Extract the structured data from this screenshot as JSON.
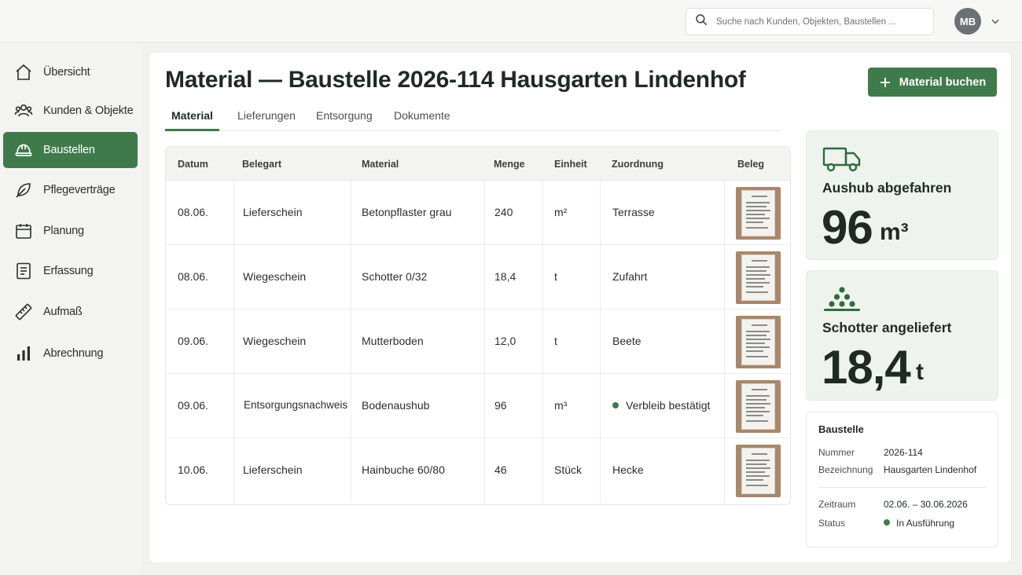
{
  "search": {
    "placeholder": "Suche nach Kunden, Objekten, Baustellen ..."
  },
  "user": {
    "initials": "MB"
  },
  "sidebar": {
    "items": [
      {
        "label": "Übersicht",
        "icon": "home-icon"
      },
      {
        "label": "Kunden & Objekte",
        "icon": "users-icon"
      },
      {
        "label": "Baustellen",
        "icon": "hardhat-icon",
        "active": true
      },
      {
        "label": "Pflegeverträge",
        "icon": "leaf-icon"
      },
      {
        "label": "Planung",
        "icon": "calendar-icon"
      },
      {
        "label": "Erfassung",
        "icon": "document-icon"
      },
      {
        "label": "Aufmaß",
        "icon": "ruler-icon"
      },
      {
        "label": "Abrechnung",
        "icon": "bar-chart-icon"
      }
    ]
  },
  "page": {
    "title": "Material — Baustelle 2026-114 Hausgarten Lindenhof",
    "primary_button": "Material buchen"
  },
  "tabs": [
    "Material",
    "Lieferungen",
    "Entsorgung",
    "Dokumente"
  ],
  "table": {
    "columns": [
      "Datum",
      "Belegart",
      "Material",
      "Menge",
      "Einheit",
      "Zuordnung",
      "Beleg"
    ],
    "rows": [
      {
        "datum": "08.06.",
        "belegart": "Lieferschein",
        "material": "Betonpflaster grau",
        "menge": "240",
        "einheit": "m²",
        "zuordnung": "Terrasse"
      },
      {
        "datum": "08.06.",
        "belegart": "Wiegeschein",
        "material": "Schotter 0/32",
        "menge": "18,4",
        "einheit": "t",
        "zuordnung": "Zufahrt"
      },
      {
        "datum": "09.06.",
        "belegart": "Wiegeschein",
        "material": "Mutterboden",
        "menge": "12,0",
        "einheit": "t",
        "zuordnung": "Beete"
      },
      {
        "datum": "09.06.",
        "belegart": "Entsorgungsnachweis",
        "material": "Bodenaushub",
        "menge": "96",
        "einheit": "m³",
        "zuordnung": "Verbleib bestätigt"
      },
      {
        "datum": "10.06.",
        "belegart": "Lieferschein",
        "material": "Hainbuche 60/80",
        "menge": "46",
        "einheit": "Stück",
        "zuordnung": "Hecke"
      }
    ]
  },
  "stats": {
    "aushub": {
      "label": "Aushub abgefahren",
      "value": "96",
      "unit": "m³",
      "icon": "truck-icon"
    },
    "schotter": {
      "label": "Schotter angeliefert",
      "value": "18,4",
      "unit": "t",
      "icon": "gravel-pile-icon"
    }
  },
  "baustelle": {
    "title": "Baustelle",
    "nummer_label": "Nummer",
    "nummer": "2026-114",
    "bezeichnung_label": "Bezeichnung",
    "bezeichnung": "Hausgarten Lindenhof",
    "zeitraum_label": "Zeitraum",
    "zeitraum": "02.06. – 30.06.2026",
    "status_label": "Status",
    "status": "In Ausführung"
  },
  "colors": {
    "accent": "#3f7a4b",
    "stat_bg": "#eef3ee"
  }
}
